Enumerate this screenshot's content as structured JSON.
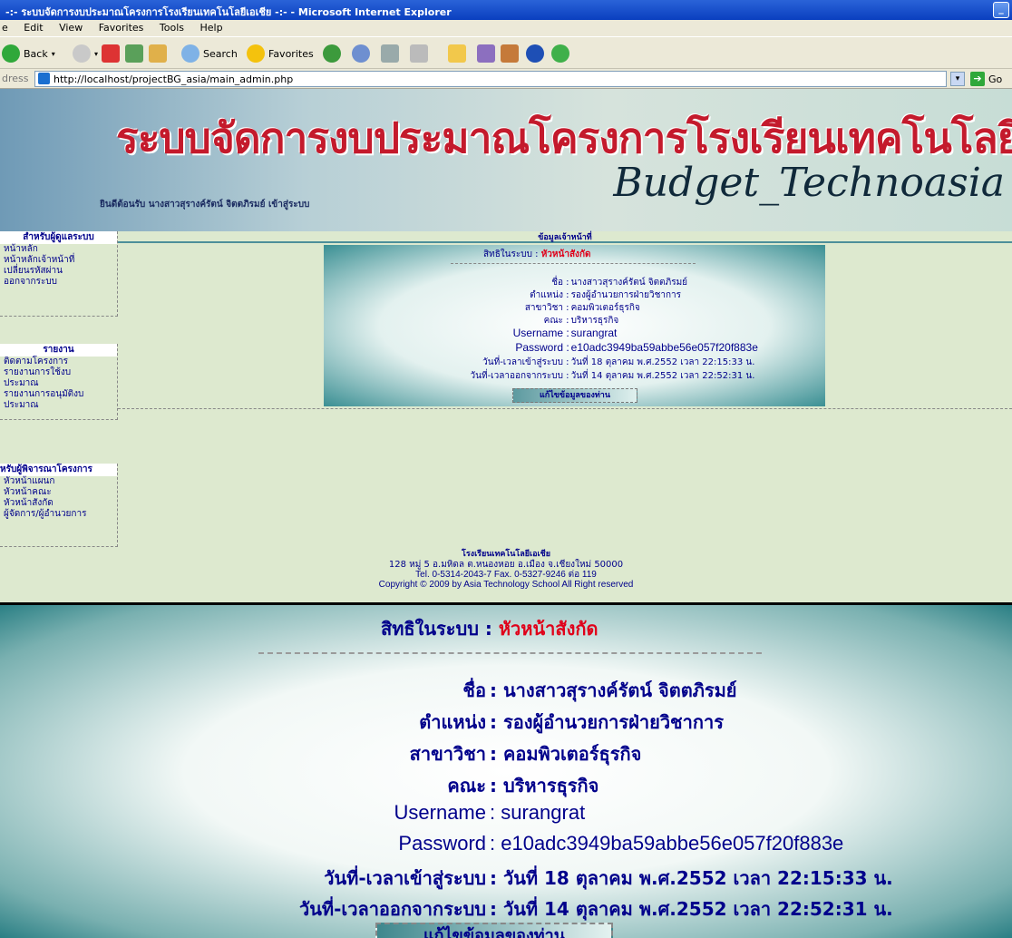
{
  "window": {
    "title": "-:- ระบบจัดการงบประมาณโครงการโรงเรียนเทคโนโลยีเอเชีย -:- - Microsoft Internet Explorer"
  },
  "menu": [
    "e",
    "Edit",
    "View",
    "Favorites",
    "Tools",
    "Help"
  ],
  "toolbar": {
    "back": "Back",
    "search": "Search",
    "favorites": "Favorites"
  },
  "address": {
    "label": "dress",
    "url": "http://localhost/projectBG_asia/main_admin.php",
    "go": "Go"
  },
  "banner": {
    "title": "ระบบจัดการงบประมาณโครงการโรงเรียนเทคโนโลยีเอเชีย",
    "brand": "Budget_Technoasia",
    "welcome": "ยินดีต้อนรับ นางสาวสุรางค์รัตน์ จิตตภิรมย์ เข้าสู่ระบบ"
  },
  "sidebar": {
    "admin": {
      "title": "สำหรับผู้ดูแลระบบ",
      "items": [
        "หน้าหลัก",
        "หน้าหลักเจ้าหน้าที่",
        "เปลี่ยนรหัสผ่าน",
        "ออกจากระบบ"
      ]
    },
    "reports": {
      "title": "รายงาน",
      "items": [
        "ติดตามโครงการ",
        "รายงานการใช้งบ",
        "ประมาณ",
        "รายงานการอนุมัติงบ",
        "ประมาณ"
      ]
    },
    "approvers": {
      "title": "หรับผู้พิจารณาโครงการ",
      "items": [
        "หัวหน้าแผนก",
        "หัวหน้าคณะ",
        "หัวหน้าสังกัด",
        "ผู้จัดการ/ผู้อำนวยการ"
      ]
    }
  },
  "profile": {
    "section_title": "ข้อมูลเจ้าหน้าที่",
    "role_label": "สิทธิในระบบ",
    "role_value": "หัวหน้าสังกัด",
    "fields": [
      {
        "label": "ชื่อ",
        "value": "นางสาวสุรางค์รัตน์ จิตตภิรมย์"
      },
      {
        "label": "ตำแหน่ง",
        "value": "รองผู้อำนวยการฝ่ายวิชาการ"
      },
      {
        "label": "สาขาวิชา",
        "value": "คอมพิวเตอร์ธุรกิจ"
      },
      {
        "label": "คณะ",
        "value": "บริหารธุรกิจ"
      },
      {
        "label": "Username",
        "value": "surangrat"
      },
      {
        "label": "Password",
        "value": "e10adc3949ba59abbe56e057f20f883e"
      },
      {
        "label": "วันที่-เวลาเข้าสู่ระบบ",
        "value": "วันที่ 18 ตุลาคม พ.ศ.2552 เวลา 22:15:33 น."
      },
      {
        "label": "วันที่-เวลาออกจากระบบ",
        "value": "วันที่ 14 ตุลาคม พ.ศ.2552 เวลา 22:52:31 น."
      }
    ],
    "edit_button": "แก้ไขข้อมูลของท่าน"
  },
  "footer": {
    "line1": "โรงเรียนเทคโนโลยีเอเชีย",
    "line2": "128 หมู่ 5 อ.มหิดล ต.หนองหอย อ.เมือง จ.เชียงใหม่ 50000",
    "line3": "Tel. 0-5314-2043-7 Fax. 0-5327-9246 ต่อ 119",
    "line4": "Copyright © 2009 by Asia Technology School All Right reserved"
  },
  "colors": {
    "label": "#00008b",
    "accent_red": "#e0001a",
    "page_bg": "#dde9cf",
    "teal": "#2a7f84"
  }
}
